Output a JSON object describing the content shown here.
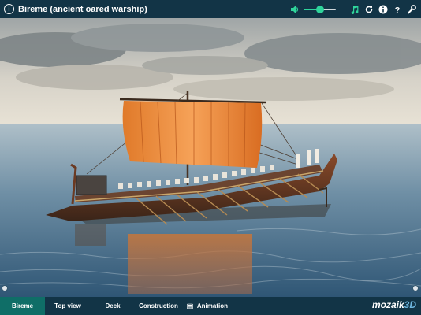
{
  "header": {
    "title": "Bireme (ancient oared warship)",
    "volume_level": 0.5,
    "icons": [
      "info-icon",
      "volume-icon",
      "music-icon",
      "reset-icon",
      "info-circle-icon",
      "help-icon",
      "settings-icon"
    ]
  },
  "tabs": [
    {
      "label": "Bireme",
      "active": true
    },
    {
      "label": "Top view",
      "active": false
    },
    {
      "label": "Deck",
      "active": false
    },
    {
      "label": "Construction",
      "active": false
    },
    {
      "label": "Animation",
      "active": false,
      "icon": "video-icon"
    }
  ],
  "brand": {
    "logo_main": "mozaik",
    "logo_accent": "3D",
    "accent_color": "#2fd59b",
    "active_tab_color": "#0f6e67"
  }
}
